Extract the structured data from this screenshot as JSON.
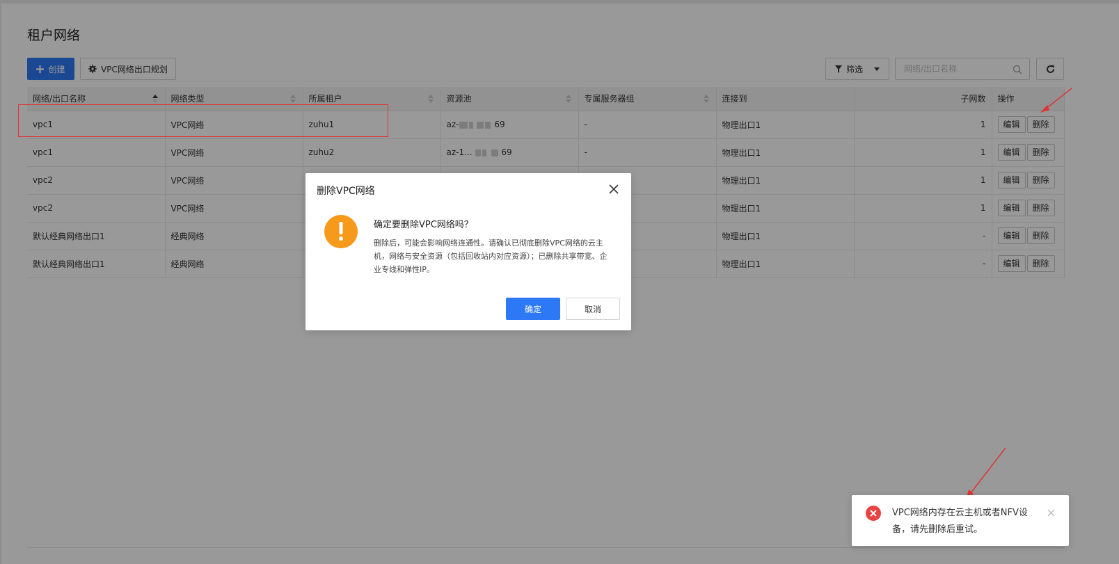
{
  "page": {
    "title": "租户网络"
  },
  "toolbar": {
    "create_label": "创建",
    "plan_label": "VPC网络出口规划",
    "filter_label": "筛选",
    "search_placeholder": "网络/出口名称"
  },
  "table": {
    "headers": [
      "网络/出口名称",
      "网络类型",
      "所属租户",
      "资源池",
      "专属服务器组",
      "连接到",
      "子网数",
      "操作"
    ],
    "rows": [
      {
        "name": "vpc1",
        "type": "VPC网络",
        "tenant": "zuhu1",
        "pool_prefix": "az-",
        "pool_suffix": "69",
        "group": "-",
        "connect": "物理出口1",
        "subnets": "1"
      },
      {
        "name": "vpc1",
        "type": "VPC网络",
        "tenant": "zuhu2",
        "pool_prefix": "az-1...",
        "pool_suffix": "69",
        "group": "-",
        "connect": "物理出口1",
        "subnets": "1"
      },
      {
        "name": "vpc2",
        "type": "VPC网络",
        "tenant": "",
        "pool_prefix": "",
        "pool_suffix": "",
        "group": "",
        "connect": "物理出口1",
        "subnets": "1"
      },
      {
        "name": "vpc2",
        "type": "VPC网络",
        "tenant": "",
        "pool_prefix": "",
        "pool_suffix": "",
        "group": "",
        "connect": "物理出口1",
        "subnets": "1"
      },
      {
        "name": "默认经典网络出口1",
        "type": "经典网络",
        "tenant": "",
        "pool_prefix": "",
        "pool_suffix": "",
        "group": "",
        "connect": "物理出口1",
        "subnets": "-"
      },
      {
        "name": "默认经典网络出口1",
        "type": "经典网络",
        "tenant": "",
        "pool_prefix": "",
        "pool_suffix": "",
        "group": "",
        "connect": "物理出口1",
        "subnets": "-"
      }
    ],
    "edit_label": "编辑",
    "delete_label": "删除"
  },
  "modal": {
    "title": "删除VPC网络",
    "heading": "确定要删除VPC网络吗？",
    "description": "删除后，可能会影响网络连通性。请确认已彻底删除VPC网络的云主机，网络与安全资源（包括回收站内对应资源）；已删除共享带宽、企业专线和弹性IP。",
    "ok_label": "确定",
    "cancel_label": "取消"
  },
  "toast": {
    "message": "VPC网络内存在云主机或者NFV设备，请先删除后重试。"
  },
  "colors": {
    "primary": "#2d78f4",
    "warning": "#f79a1c",
    "error": "#e84343",
    "annotation": "#e03333"
  }
}
